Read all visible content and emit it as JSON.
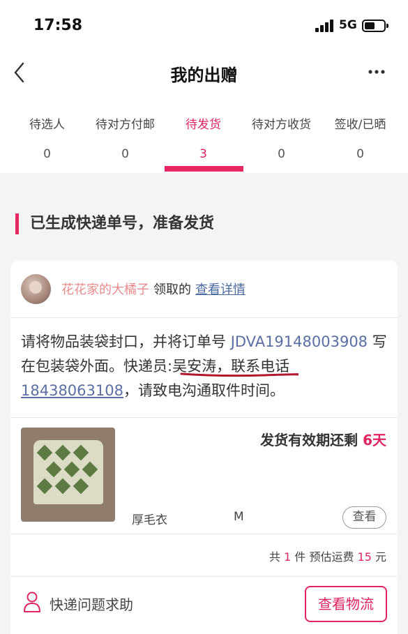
{
  "status_bar": {
    "time": "17:58",
    "network": "5G"
  },
  "nav": {
    "title": "我的出赠"
  },
  "tabs": [
    {
      "label": "待选人",
      "count": "0"
    },
    {
      "label": "待对方付邮",
      "count": "0"
    },
    {
      "label": "待发货",
      "count": "3"
    },
    {
      "label": "待对方收货",
      "count": "0"
    },
    {
      "label": "签收/已晒",
      "count": "0"
    }
  ],
  "section_title": "已生成快递单号，准备发货",
  "card": {
    "recipient_name": "花花家的大橘子",
    "recipient_verb": "领取的",
    "details_link": "查看详情",
    "instr_1": "请将物品装袋封口，并将订单号 ",
    "order_no": "JDVA19148003908",
    "instr_2": " 写在包装袋外面。",
    "courier": "快递员:吴安涛，",
    "instr_3": "联系电话",
    "phone": "18438063108",
    "instr_4": "，请致电沟通取件时间。",
    "deadline_prefix": "发货有效期还剩 ",
    "deadline_days": "6天",
    "item_name": "厚毛衣",
    "item_size": "M",
    "view_button": "查看",
    "totals_1": "共 ",
    "qty": "1",
    "totals_2": " 件  预估运费 ",
    "fee": "15",
    "totals_3": " 元",
    "help_label": "快递问题求助",
    "track_button": "查看物流"
  },
  "colors": {
    "accent": "#e8265f",
    "link": "#4b6aa0",
    "recipient_name": "#e88b8b"
  }
}
